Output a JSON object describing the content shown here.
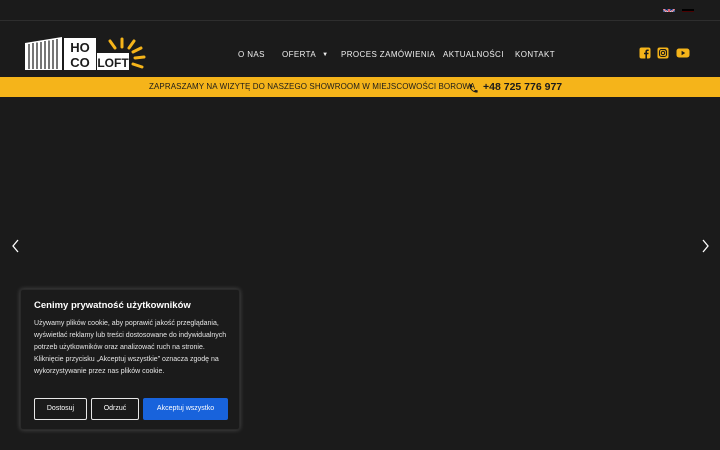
{
  "language_flags": [
    {
      "icon": "uk-flag-icon",
      "lang": "EN"
    },
    {
      "icon": "germany-flag-icon",
      "lang": "DE"
    }
  ],
  "logo": {
    "text_top": "HO",
    "text_bottom": "CO",
    "text_right": "LOFT",
    "accent_color": "#f5b41a"
  },
  "nav": {
    "items": [
      {
        "label": "O NAS"
      },
      {
        "label": "OFERTA",
        "has_dropdown": true
      },
      {
        "label": "PROCES ZAMÓWIENIA"
      },
      {
        "label": "AKTUALNOŚCI"
      },
      {
        "label": "KONTAKT"
      }
    ],
    "dropdown_caret": "▼"
  },
  "social": [
    {
      "icon": "facebook-icon"
    },
    {
      "icon": "instagram-icon"
    },
    {
      "icon": "youtube-icon"
    }
  ],
  "banner": {
    "text": "ZAPRASZAMY NA WIZYTĘ DO NASZEGO SHOWROOM W MIEJSCOWOŚCI BOROWA",
    "phone": "+48 725 776 977",
    "background": "#f5b41a"
  },
  "slider": {
    "prev_icon": "chevron-left-icon",
    "next_icon": "chevron-right-icon"
  },
  "cookie_banner": {
    "title": "Cenimy prywatność użytkowników",
    "body": "Używamy plików cookie, aby poprawić jakość przeglądania, wyświetlać reklamy lub treści dostosowane do indywidualnych potrzeb użytkowników oraz analizować ruch na stronie. Kliknięcie przycisku „Akceptuj wszystkie” oznacza zgodę na wykorzystywanie przez nas plików cookie.",
    "customize_label": "Dostosuj",
    "reject_label": "Odrzuć",
    "accept_label": "Akceptuj wszystko",
    "accept_color": "#1863dc"
  }
}
